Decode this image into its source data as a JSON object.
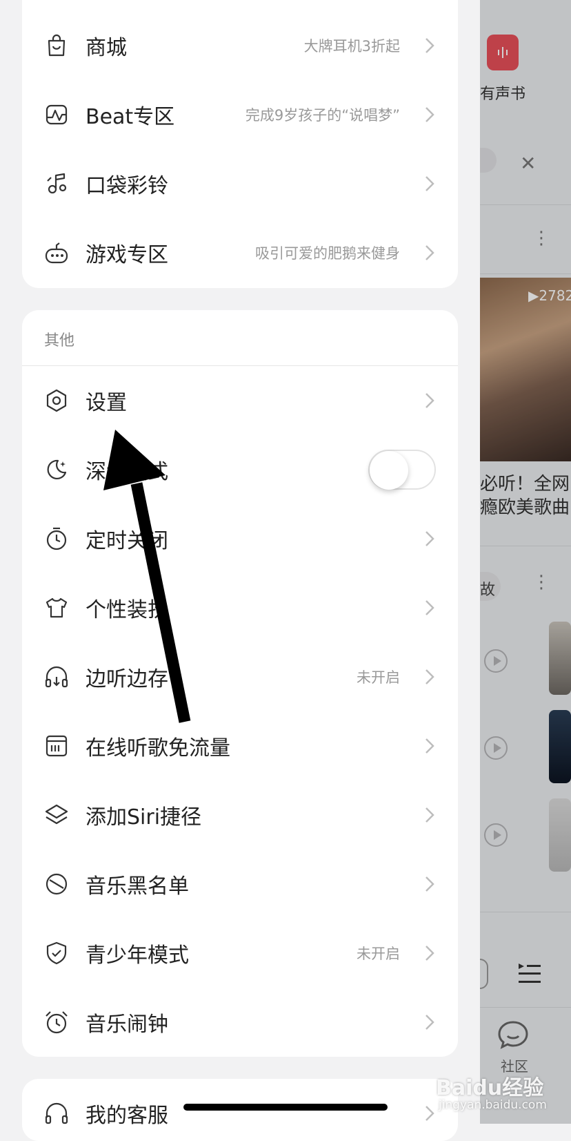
{
  "background_app": {
    "tile_label": "有声书",
    "play_count": "▶2782",
    "playlist_title_line1": "必听！全网",
    "playlist_title_line2": "瘾欧美歌曲",
    "pill_label": "故",
    "community_label": "社区"
  },
  "top_card": {
    "items": [
      {
        "label": "商城",
        "sub": "大牌耳机3折起",
        "icon": "shopping-bag-icon"
      },
      {
        "label": "Beat专区",
        "sub": "完成9岁孩子的“说唱梦”",
        "icon": "beat-wave-icon"
      },
      {
        "label": "口袋彩铃",
        "sub": "",
        "icon": "music-note-icon"
      },
      {
        "label": "游戏专区",
        "sub": "吸引可爱的肥鹅来健身",
        "icon": "game-controller-icon"
      }
    ]
  },
  "other_card": {
    "title": "其他",
    "items": [
      {
        "label": "设置",
        "sub": "",
        "icon": "hexagon-gear-icon"
      },
      {
        "label": "深色模式",
        "sub": "",
        "icon": "moon-icon",
        "toggle": false
      },
      {
        "label": "定时关闭",
        "sub": "",
        "icon": "timer-icon"
      },
      {
        "label": "个性装扮",
        "sub": "",
        "icon": "tshirt-icon"
      },
      {
        "label": "边听边存",
        "sub": "未开启",
        "icon": "headphones-download-icon"
      },
      {
        "label": "在线听歌免流量",
        "sub": "",
        "icon": "data-card-icon"
      },
      {
        "label": "添加Siri捷径",
        "sub": "",
        "icon": "layers-icon"
      },
      {
        "label": "音乐黑名单",
        "sub": "",
        "icon": "block-icon"
      },
      {
        "label": "青少年模式",
        "sub": "未开启",
        "icon": "shield-check-icon"
      },
      {
        "label": "音乐闹钟",
        "sub": "",
        "icon": "alarm-clock-icon"
      }
    ]
  },
  "service_card": {
    "label": "我的客服",
    "icon": "headset-icon"
  },
  "watermark": {
    "text": "Baidu经验",
    "url": "jingyan.baidu.com"
  },
  "colors": {
    "accent_red": "#e8505a",
    "arrow": "#000000"
  }
}
